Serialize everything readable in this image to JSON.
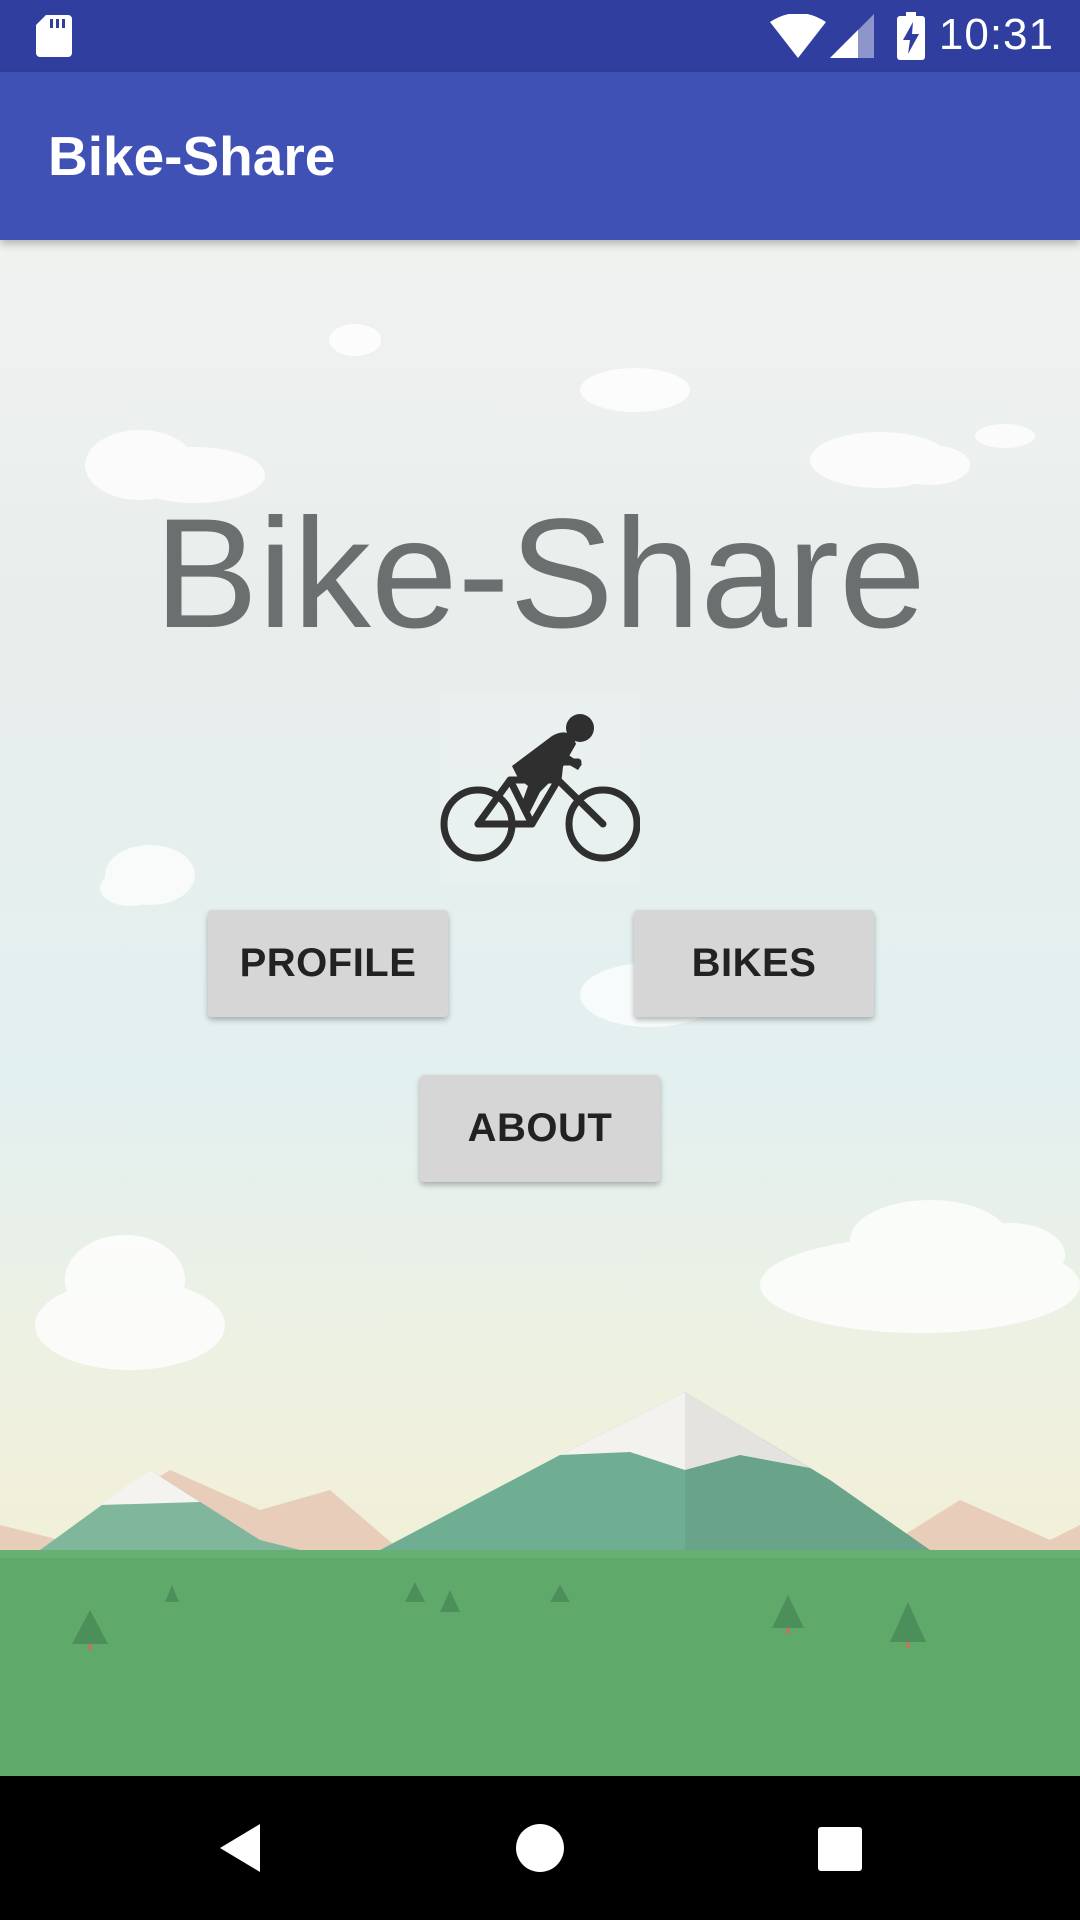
{
  "status_bar": {
    "time": "10:31",
    "icons": [
      "sd-card-icon",
      "wifi-icon",
      "cell-signal-icon",
      "battery-charging-icon"
    ],
    "background": "#303f9f"
  },
  "app_bar": {
    "title": "Bike-Share",
    "background": "#3f51b5"
  },
  "main": {
    "heading": "Bike-Share",
    "icon": "bicycle-rider-icon",
    "buttons": {
      "profile": "PROFILE",
      "bikes": "BIKES",
      "about": "ABOUT"
    }
  },
  "nav_bar": {
    "icons": [
      "back-icon",
      "home-icon",
      "recents-icon"
    ]
  }
}
